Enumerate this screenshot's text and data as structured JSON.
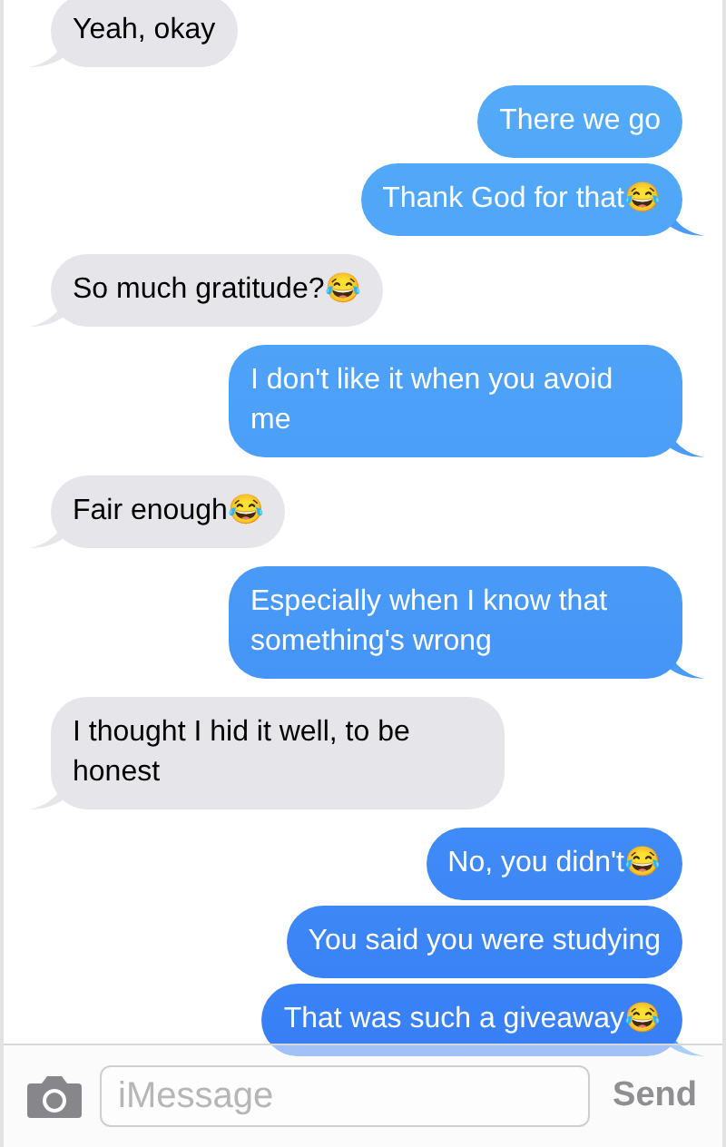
{
  "messages": [
    {
      "text": "Yeah, okay",
      "kind": "incoming",
      "tail": true
    },
    {
      "text": "There we go",
      "kind": "outgoing",
      "tail": false
    },
    {
      "text": "Thank God for that😂",
      "kind": "outgoing",
      "tail": true
    },
    {
      "text": "So much gratitude?😂",
      "kind": "incoming",
      "tail": true
    },
    {
      "text": "I don't like it when you avoid me",
      "kind": "outgoing",
      "tail": true
    },
    {
      "text": "Fair enough😂",
      "kind": "incoming",
      "tail": true
    },
    {
      "text": "Especially when I know that something's wrong",
      "kind": "outgoing",
      "tail": true
    },
    {
      "text": "I thought I hid it well, to be honest",
      "kind": "incoming",
      "tail": true
    },
    {
      "text": "No, you didn't😂",
      "kind": "outgoing",
      "tail": false
    },
    {
      "text": "You said you were studying",
      "kind": "outgoing",
      "tail": false
    },
    {
      "text": "That was such a giveaway😂",
      "kind": "outgoing",
      "tail": true
    }
  ],
  "composer": {
    "placeholder": "iMessage",
    "send": "Send"
  }
}
